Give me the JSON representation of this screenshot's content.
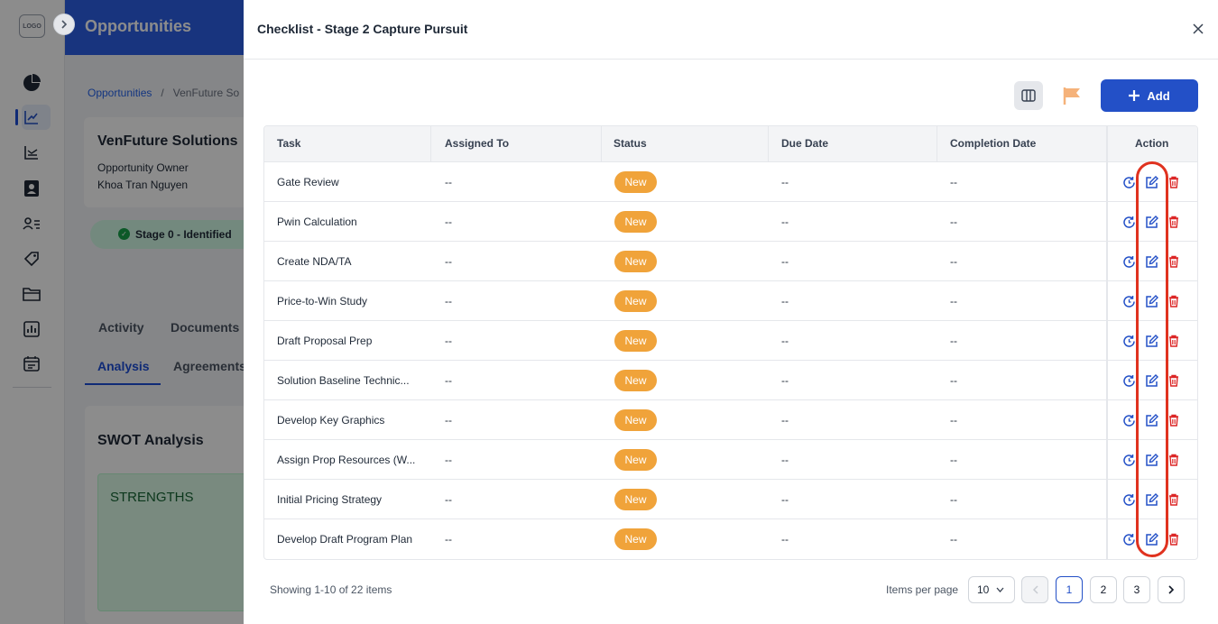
{
  "background": {
    "logo_text": "LOGO",
    "page_title": "Opportunities",
    "breadcrumb": {
      "root": "Opportunities",
      "separator": "/",
      "current": "VenFuture So"
    },
    "opportunity": {
      "name": "VenFuture Solutions",
      "owner_label": "Opportunity Owner",
      "owner_name": "Khoa Tran Nguyen",
      "stage": "Stage 0 - Identified"
    },
    "tabs_row1": [
      "Activity",
      "Documents"
    ],
    "tabs_row2": [
      "Analysis",
      "Agreements"
    ],
    "swot_title": "SWOT Analysis",
    "strengths_label": "STRENGTHS",
    "nav_icons": [
      "pie-chart-icon",
      "trend-chart-icon",
      "chart-line-icon",
      "contact-card-icon",
      "user-list-icon",
      "tag-icon",
      "folder-icon",
      "bar-chart-icon",
      "calendar-icon"
    ]
  },
  "drawer": {
    "title": "Checklist - Stage 2 Capture Pursuit",
    "add_label": "Add",
    "columns": [
      "Task",
      "Assigned To",
      "Status",
      "Due Date",
      "Completion Date",
      "Action"
    ],
    "rows": [
      {
        "task": "Gate Review",
        "assigned": "--",
        "status": "New",
        "due": "--",
        "completion": "--"
      },
      {
        "task": "Pwin Calculation",
        "assigned": "--",
        "status": "New",
        "due": "--",
        "completion": "--"
      },
      {
        "task": "Create NDA/TA",
        "assigned": "--",
        "status": "New",
        "due": "--",
        "completion": "--"
      },
      {
        "task": "Price-to-Win Study",
        "assigned": "--",
        "status": "New",
        "due": "--",
        "completion": "--"
      },
      {
        "task": "Draft Proposal Prep",
        "assigned": "--",
        "status": "New",
        "due": "--",
        "completion": "--"
      },
      {
        "task": "Solution Baseline Technic...",
        "assigned": "--",
        "status": "New",
        "due": "--",
        "completion": "--"
      },
      {
        "task": "Develop Key Graphics",
        "assigned": "--",
        "status": "New",
        "due": "--",
        "completion": "--"
      },
      {
        "task": "Assign Prop Resources (W...",
        "assigned": "--",
        "status": "New",
        "due": "--",
        "completion": "--"
      },
      {
        "task": "Initial Pricing Strategy",
        "assigned": "--",
        "status": "New",
        "due": "--",
        "completion": "--"
      },
      {
        "task": "Develop Draft Program Plan",
        "assigned": "--",
        "status": "New",
        "due": "--",
        "completion": "--"
      }
    ],
    "pagination": {
      "summary": "Showing 1-10 of 22 items",
      "items_per_page_label": "Items per page",
      "items_per_page": "10",
      "pages": [
        "1",
        "2",
        "3"
      ],
      "current_page": "1"
    },
    "colors": {
      "primary": "#2350c7",
      "status_new": "#f0a33a",
      "delete": "#dc2626",
      "highlight": "#e0321f",
      "flag": "#f5b27a"
    }
  }
}
